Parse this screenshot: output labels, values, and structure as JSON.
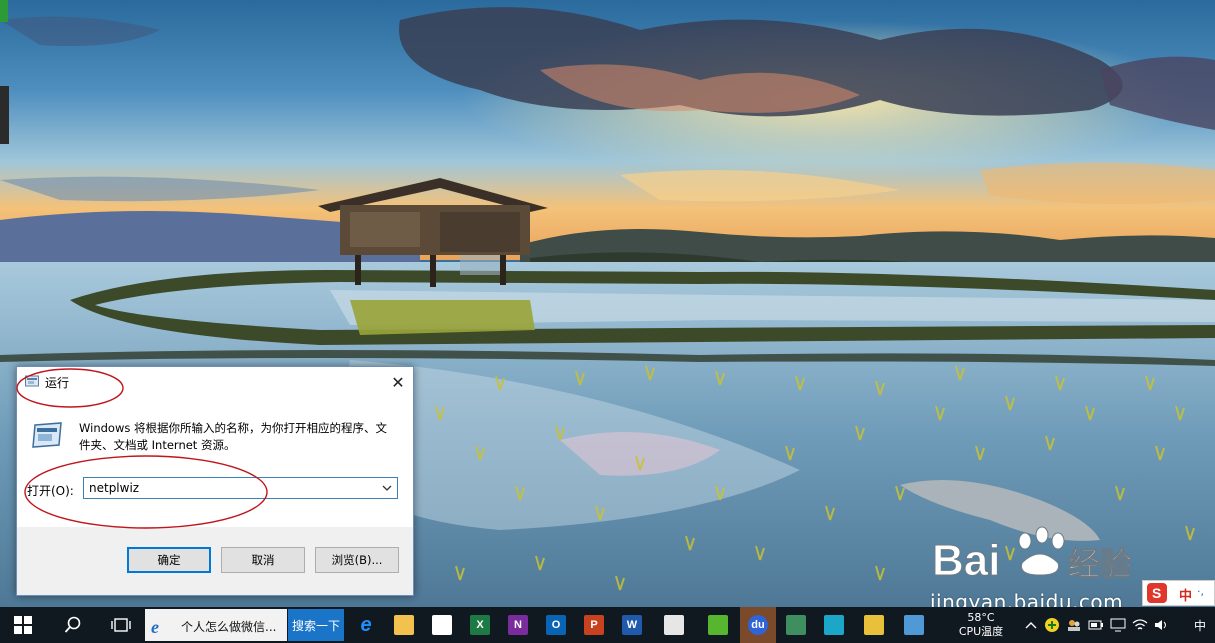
{
  "run_dialog": {
    "title": "运行",
    "close_glyph": "✕",
    "description": "Windows 将根据你所输入的名称，为你打开相应的程序、文件夹、文档或 Internet 资源。",
    "open_label": "打开(O):",
    "command_value": "netplwiz",
    "ok_label": "确定",
    "cancel_label": "取消",
    "browse_label": "浏览(B)..."
  },
  "watermark": {
    "logo_text": "Bai 经验",
    "url": "jingyan.baidu.com"
  },
  "ime": {
    "lang": "中",
    "extra": "·,"
  },
  "taskbar": {
    "ie_task_label": "个人怎么做微信...",
    "search_label": "搜索一下",
    "apps": [
      {
        "name": "edge",
        "label": "e",
        "color": "#1e90ff"
      },
      {
        "name": "file-explorer",
        "label": "",
        "color": "#f2c14e"
      },
      {
        "name": "store",
        "label": "",
        "color": "#ffffff"
      },
      {
        "name": "excel",
        "label": "X",
        "color": "#1d7a44"
      },
      {
        "name": "onenote",
        "label": "N",
        "color": "#7a2c9e"
      },
      {
        "name": "outlook",
        "label": "O",
        "color": "#0a64b5"
      },
      {
        "name": "powerpoint",
        "label": "P",
        "color": "#c9421f"
      },
      {
        "name": "word",
        "label": "W",
        "color": "#1f5aab"
      },
      {
        "name": "paint",
        "label": "",
        "color": "#e6e6e6"
      },
      {
        "name": "green-app",
        "label": "",
        "color": "#57b530"
      },
      {
        "name": "baidu-app",
        "label": "du",
        "color": "#2f63d8"
      },
      {
        "name": "photo-app",
        "label": "",
        "color": "#3e8e5f"
      },
      {
        "name": "settings-app",
        "label": "",
        "color": "#1ca7c9"
      },
      {
        "name": "notes-app",
        "label": "",
        "color": "#e8c03a"
      },
      {
        "name": "blue-app",
        "label": "",
        "color": "#4f9ad6"
      }
    ],
    "temperature": "58°C",
    "temperature_caption": "CPU温度",
    "tray_lang": "中"
  }
}
